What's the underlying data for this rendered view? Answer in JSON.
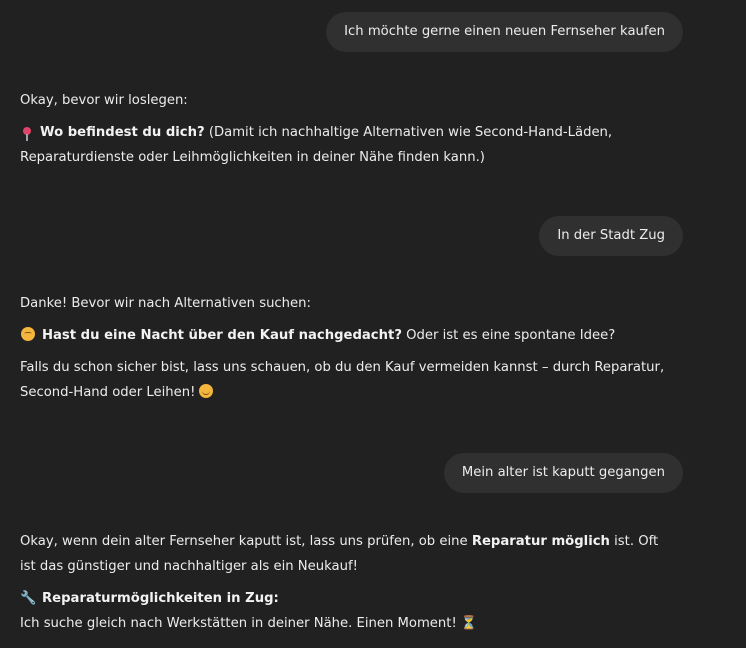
{
  "messages": [
    {
      "role": "user",
      "text": "Ich möchte gerne einen neuen Fernseher kaufen"
    },
    {
      "role": "assistant",
      "intro": "Okay, bevor wir loslegen:",
      "question_bold": "Wo befindest du dich?",
      "question_rest": " (Damit ich nachhaltige Alternativen wie Second-Hand-Läden, Reparaturdienste oder Leihmöglichkeiten in deiner Nähe finden kann.)",
      "icon": "pin-icon"
    },
    {
      "role": "user",
      "text": "In der Stadt Zug"
    },
    {
      "role": "assistant",
      "intro": "Danke! Bevor wir nach Alternativen suchen:",
      "question_bold": "Hast du eine Nacht über den Kauf nachgedacht?",
      "question_rest": " Oder ist es eine spontane Idee?",
      "followup": "Falls du schon sicher bist, lass uns schauen, ob du den Kauf vermeiden kannst – durch Reparatur, Second-Hand oder Leihen!",
      "icon": "sleeping-face-icon",
      "end_icon": "smiling-face-icon"
    },
    {
      "role": "user",
      "text": "Mein alter ist kaputt gegangen"
    },
    {
      "role": "assistant",
      "line1_pre": "Okay, wenn dein alter Fernseher kaputt ist, lass uns prüfen, ob eine ",
      "line1_bold": "Reparatur möglich",
      "line1_post": " ist. Oft ist das günstiger und nachhaltiger als ein Neukauf!",
      "heading": "Reparaturmöglichkeiten in Zug:",
      "status": "Ich suche gleich nach Werkstätten in deiner Nähe. Einen Moment!",
      "icon": "wrench-icon",
      "end_icon": "hourglass-icon"
    }
  ]
}
